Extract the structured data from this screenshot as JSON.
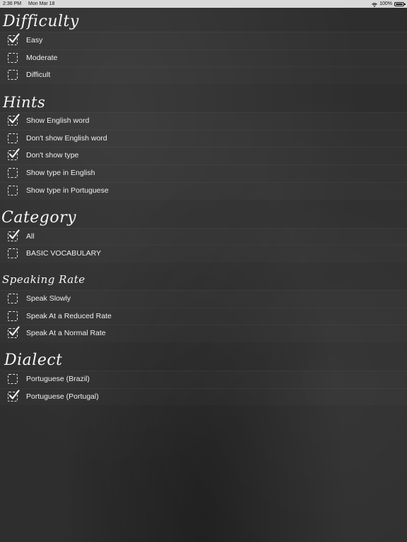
{
  "status": {
    "time": "2:36 PM",
    "date": "Mon Mar 18",
    "battery": "100%"
  },
  "sections": {
    "difficulty": {
      "title": "Difficulty",
      "options": [
        {
          "label": "Easy",
          "checked": true
        },
        {
          "label": "Moderate",
          "checked": false
        },
        {
          "label": "Difficult",
          "checked": false
        }
      ]
    },
    "hints": {
      "title": "Hints",
      "options": [
        {
          "label": "Show English word",
          "checked": true
        },
        {
          "label": "Don't show English word",
          "checked": false
        },
        {
          "label": "Don't show type",
          "checked": true
        },
        {
          "label": "Show type in English",
          "checked": false
        },
        {
          "label": "Show type in Portuguese",
          "checked": false
        }
      ]
    },
    "category": {
      "title": "Category",
      "options": [
        {
          "label": "All",
          "checked": true
        },
        {
          "label": "BASIC VOCABULARY",
          "checked": false
        }
      ]
    },
    "speaking_rate": {
      "title": "Speaking Rate",
      "options": [
        {
          "label": "Speak Slowly",
          "checked": false
        },
        {
          "label": "Speak At a Reduced Rate",
          "checked": false
        },
        {
          "label": "Speak At a Normal Rate",
          "checked": true
        }
      ]
    },
    "dialect": {
      "title": "Dialect",
      "options": [
        {
          "label": "Portuguese (Brazil)",
          "checked": false
        },
        {
          "label": "Portuguese (Portugal)",
          "checked": true
        }
      ]
    }
  },
  "icons": {
    "checkbox": "checkbox-icon",
    "checkmark": "checkmark-icon",
    "wifi": "wifi-icon",
    "battery": "battery-icon"
  },
  "colors": {
    "background": "#2e2e2e",
    "text": "#f0f0f0",
    "statusbar": "#d9d9d9"
  }
}
